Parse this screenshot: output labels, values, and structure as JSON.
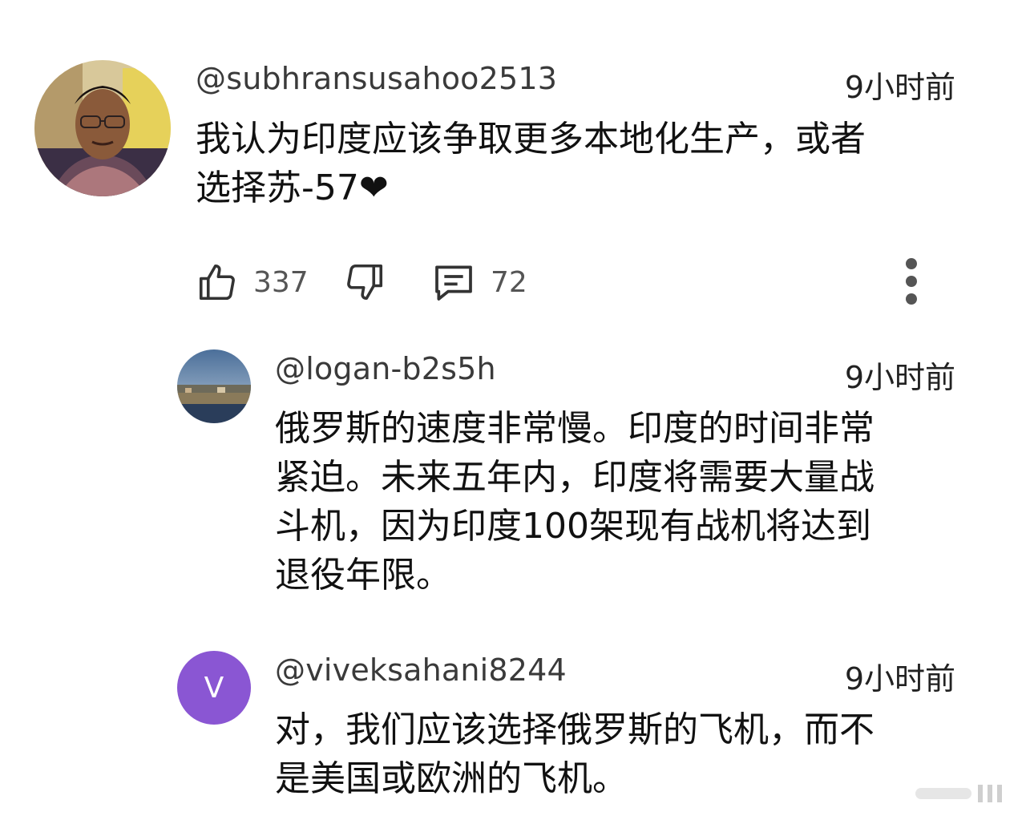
{
  "comments": [
    {
      "author": "@subhransusahoo2513",
      "time": "9小时前",
      "text": "我认为印度应该争取更多本地化生产，或者\n选择苏-57❤",
      "likes": "337",
      "replies_count": "72",
      "avatar_icon": "profile-photo"
    },
    {
      "author": "@logan-b2s5h",
      "time": "9小时前",
      "text": "俄罗斯的速度非常慢。印度的时间非常\n紧迫。未来五年内，印度将需要大量战\n斗机，因为印度100架现有战机将达到\n退役年限。",
      "avatar_icon": "landscape-photo"
    },
    {
      "author": "@viveksahani8244",
      "time": "9小时前",
      "text": "对，我们应该选择俄罗斯的飞机，而不\n是美国或欧洲的飞机。",
      "avatar_letter": "V",
      "avatar_color": "#8a56d3"
    }
  ],
  "icons": {
    "like": "thumbs-up-icon",
    "dislike": "thumbs-down-icon",
    "reply": "comment-bubble-icon",
    "more": "more-vertical-icon"
  }
}
